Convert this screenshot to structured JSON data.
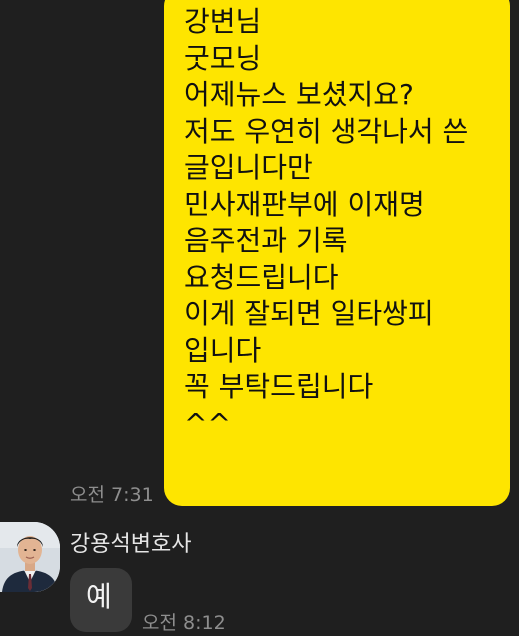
{
  "conversation": {
    "outgoing_message": {
      "lines": [
        "강변님",
        "굿모닝",
        "어제뉴스 보셨지요?",
        "저도 우연히 생각나서 쓴",
        "글입니다만",
        "민사재판부에 이재명",
        "음주전과 기록",
        "요청드립니다",
        "이게 잘되면 일타쌍피",
        "입니다",
        "꼭 부탁드립니다",
        "^^"
      ],
      "time": "오전 7:31",
      "bubble_color": "#fee500"
    },
    "incoming_message": {
      "sender_name": "강용석변호사",
      "text": "예",
      "time": "오전 8:12",
      "bubble_color": "#3a3a3a"
    }
  },
  "theme": {
    "background": "#1f1f1f",
    "timestamp_color": "#8e8e8e",
    "name_color": "#e6e6e6"
  }
}
